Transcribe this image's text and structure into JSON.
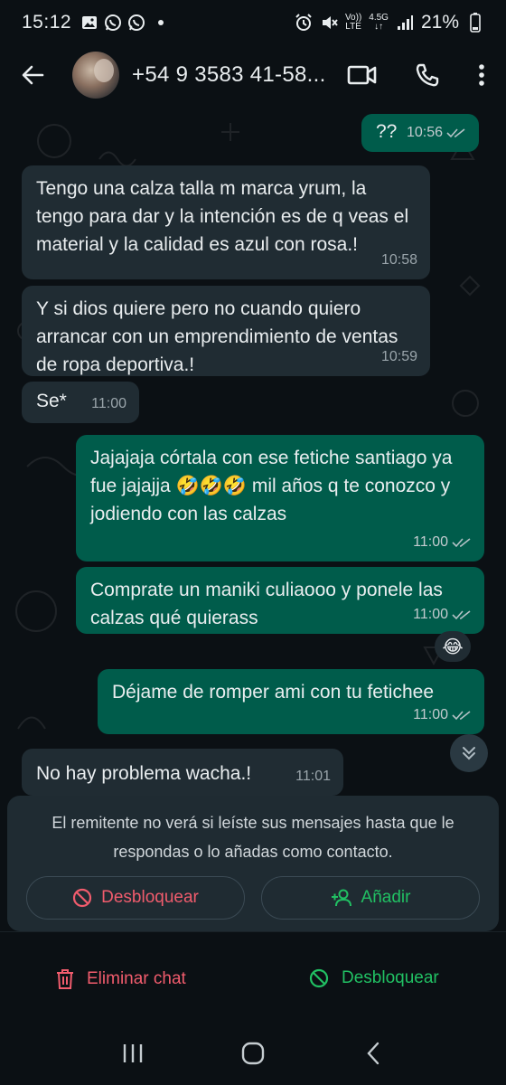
{
  "status_bar": {
    "time": "15:12",
    "battery": "21%",
    "network_top": "4.5G",
    "volte_label": "Vo))",
    "lte_label": "LTE"
  },
  "header": {
    "contact": "+54 9 3583 41-58..."
  },
  "messages": [
    {
      "dir": "out",
      "text": "??",
      "time": "10:56",
      "ticks": true
    },
    {
      "dir": "in",
      "text": "Tengo una calza talla m marca yrum, la tengo para dar y la intención es de q veas el material y la calidad es azul con rosa.!",
      "time": "10:58"
    },
    {
      "dir": "in",
      "text": "Y si dios quiere pero no cuando quiero arrancar con un emprendimiento de ventas de ropa deportiva.!",
      "time": "10:59"
    },
    {
      "dir": "in",
      "text": "Se*",
      "time": "11:00"
    },
    {
      "dir": "out",
      "text": "Jajajaja córtala con ese fetiche santiago ya fue jajajja 🤣🤣🤣 mil años q te conozco y jodiendo con las calzas",
      "time": "11:00",
      "ticks": true
    },
    {
      "dir": "out",
      "text": "Comprate un maniki culiaooo y ponele las calzas qué quierass",
      "time": "11:00",
      "ticks": true,
      "reaction": "😂"
    },
    {
      "dir": "out",
      "text": "Déjame de romper ami con tu fetichee",
      "time": "11:00",
      "ticks": true
    },
    {
      "dir": "in",
      "text": "No hay problema wacha.!",
      "time": "11:01"
    }
  ],
  "notice": {
    "text": "El remitente no verá si leíste sus mensajes hasta que le respondas o lo añadas como contacto.",
    "unblock_label": "Desbloquear",
    "add_label": "Añadir"
  },
  "actions": {
    "delete_label": "Eliminar chat",
    "unblock_label": "Desbloquear"
  },
  "colors": {
    "incoming_bubble": "#202c33",
    "outgoing_bubble": "#005c4b",
    "danger": "#f15c6d",
    "accent": "#21c063"
  }
}
